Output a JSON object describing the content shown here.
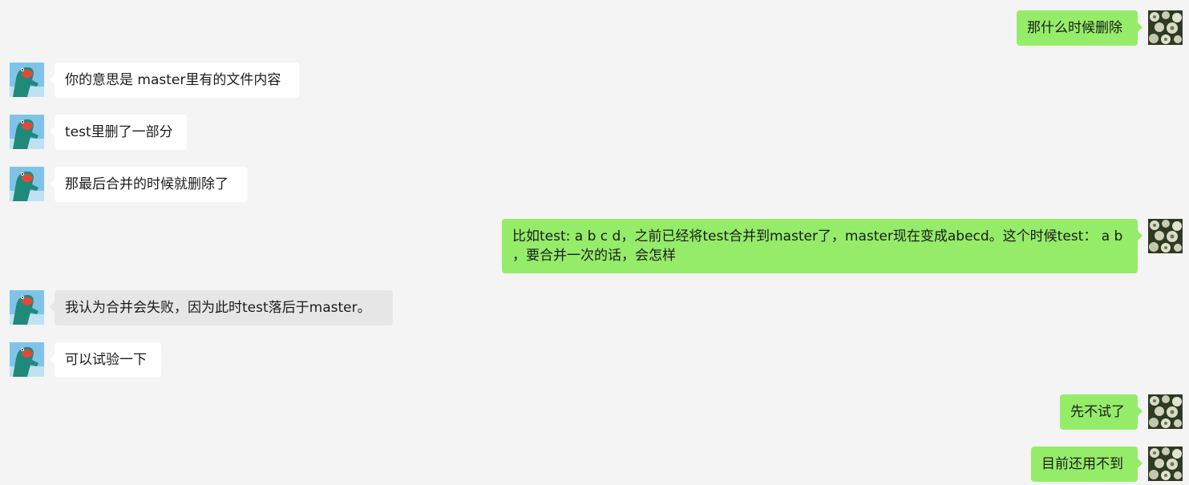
{
  "messages": [
    {
      "side": "right",
      "text": "那什么时候删除"
    },
    {
      "side": "left",
      "text": "你的意思是 master里有的文件内容"
    },
    {
      "side": "left",
      "text": "test里删了一部分"
    },
    {
      "side": "left",
      "text": "那最后合并的时候就删除了"
    },
    {
      "side": "right",
      "text": "比如test: a b c d，之前已经将test合并到master了，master现在变成abecd。这个时候test： a b ，要合并一次的话，会怎样"
    },
    {
      "side": "left",
      "text": "我认为合并会失败，因为此时test落后于master。"
    },
    {
      "side": "left",
      "text": "可以试验一下"
    },
    {
      "side": "right",
      "text": "先不试了"
    },
    {
      "side": "right",
      "text": "目前还用不到"
    }
  ],
  "colors": {
    "background": "#f4f4f4",
    "self_bubble": "#95ec69",
    "other_bubble": "#ffffff",
    "selected_bubble": "#e6e6e6"
  },
  "icons": {
    "self_avatar": "flower-photo-avatar",
    "other_avatar": "dinosaur-cartoon-avatar"
  }
}
